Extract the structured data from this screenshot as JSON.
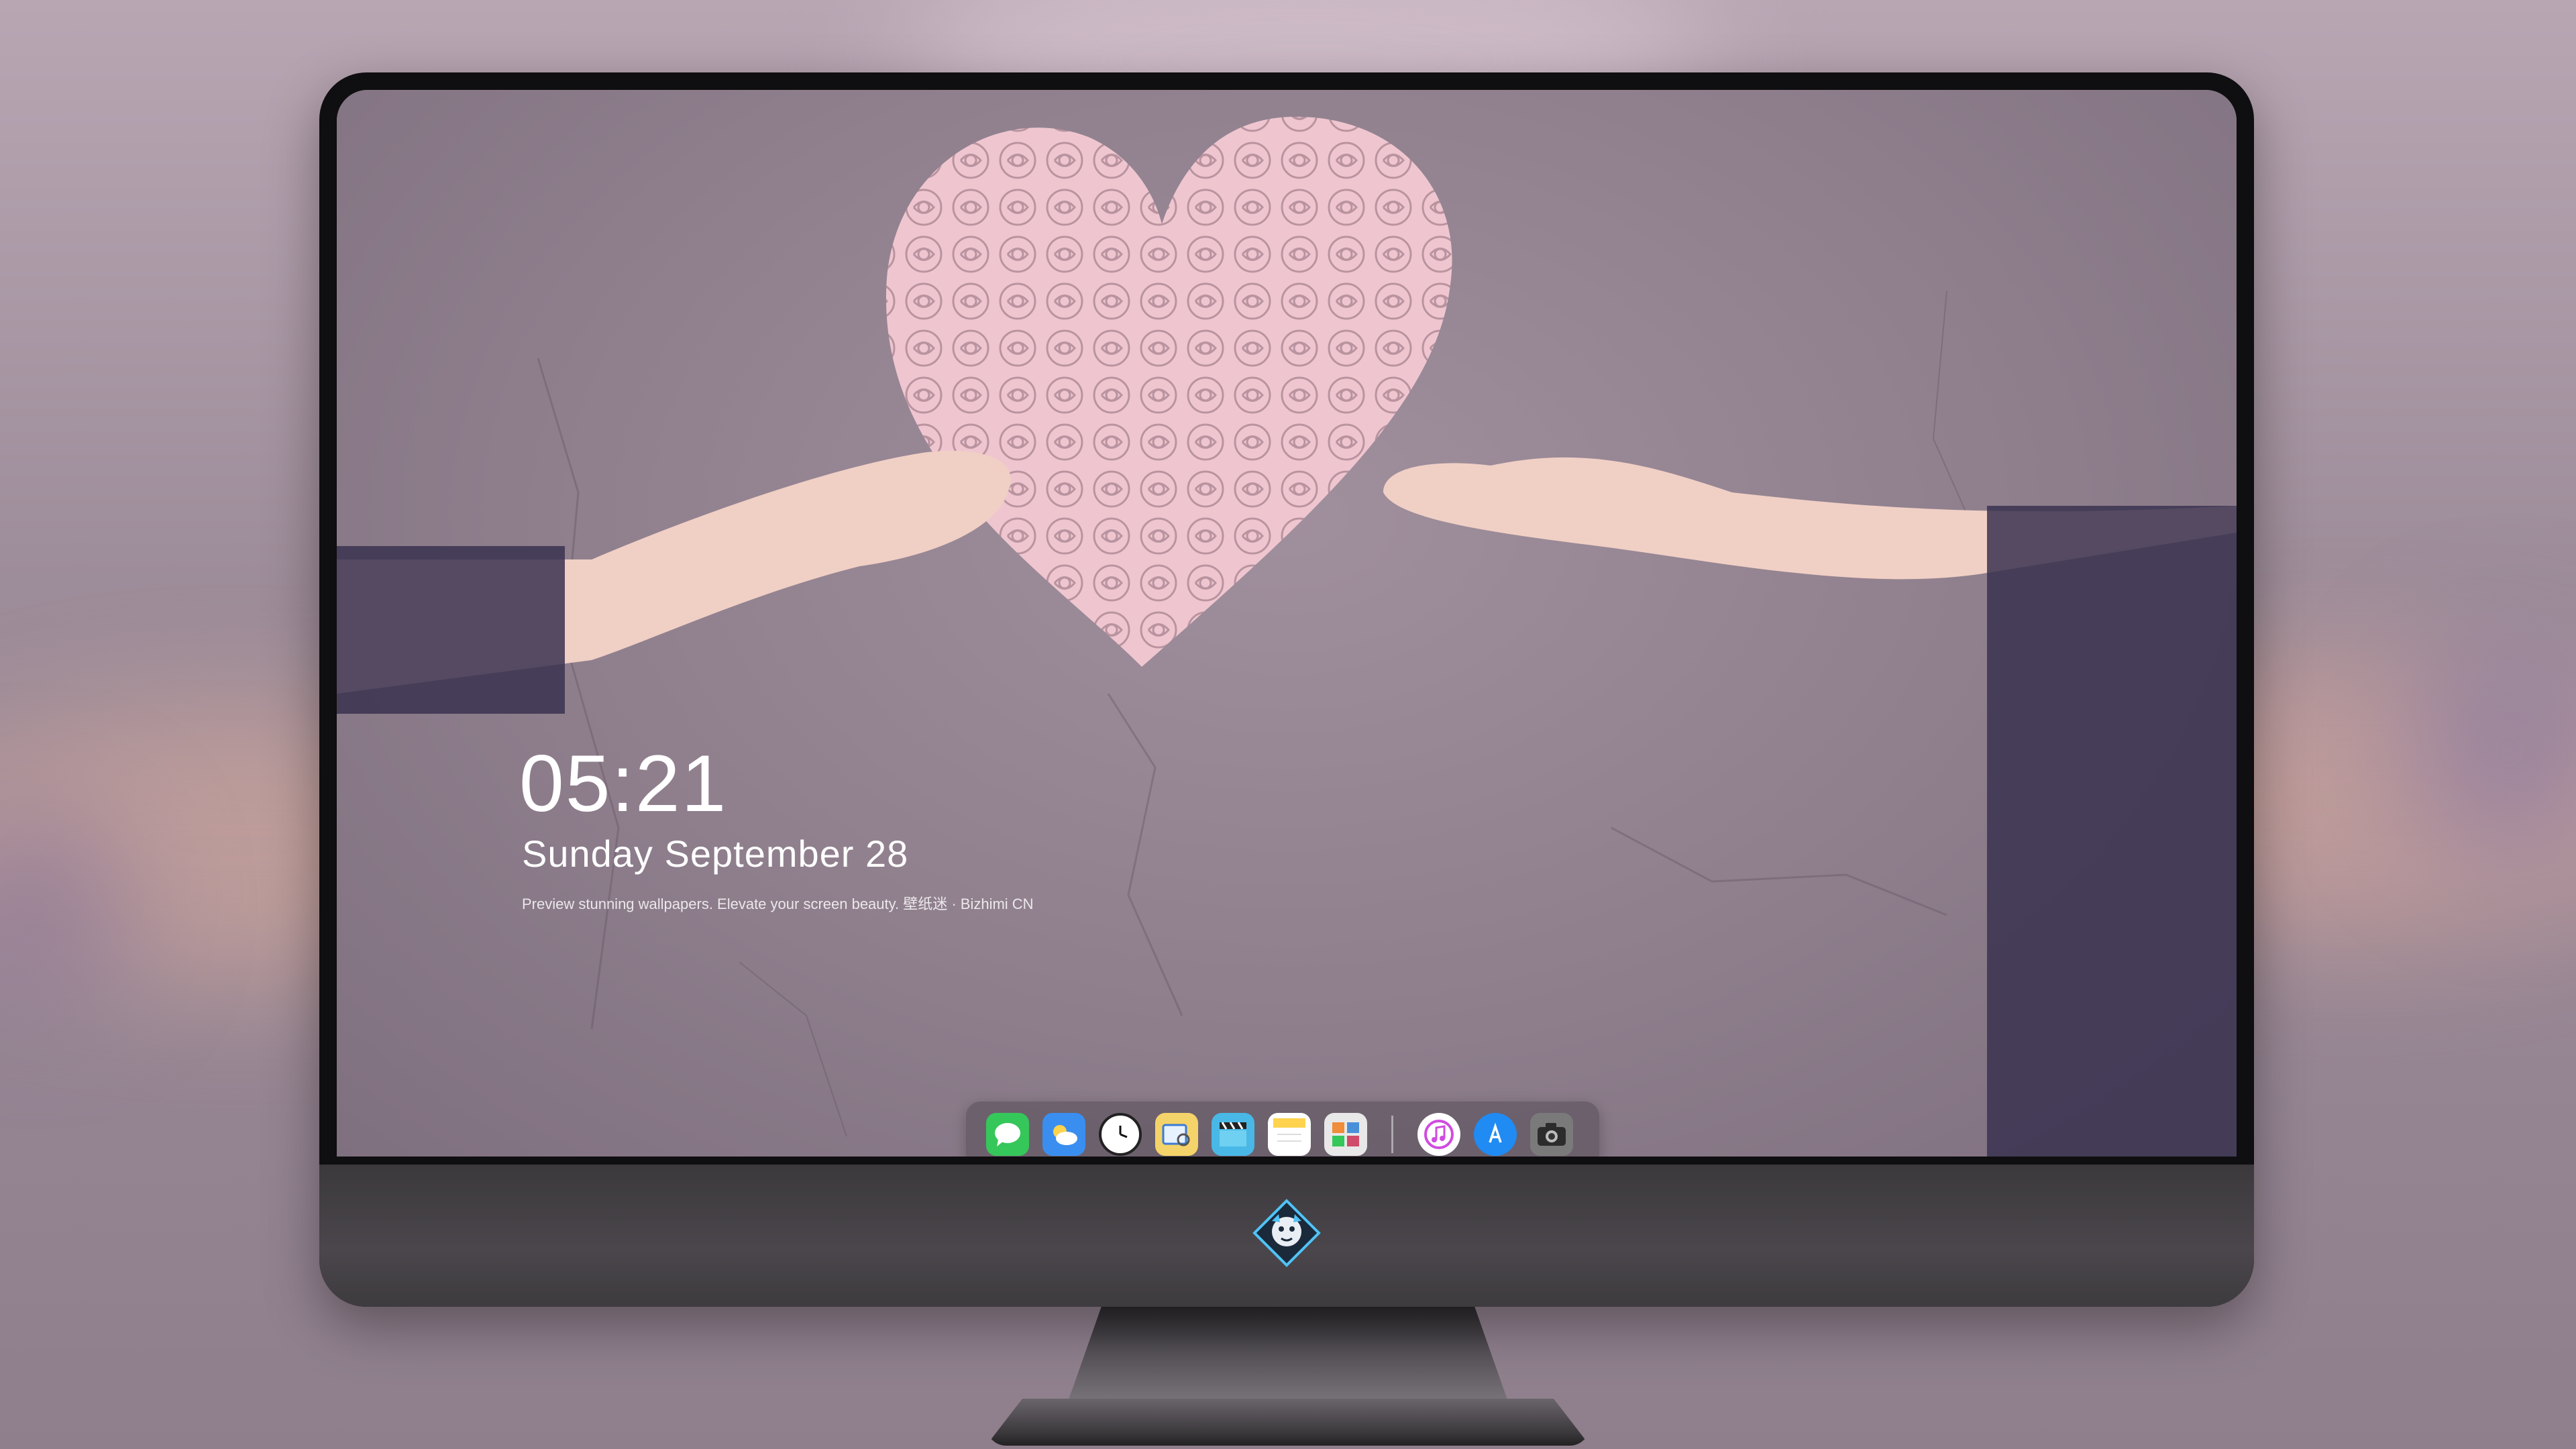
{
  "lock_screen": {
    "time": "05:21",
    "date": "Sunday September  28",
    "tagline": "Preview stunning wallpapers. Elevate your screen beauty. 壁纸迷 · Bizhimi CN"
  },
  "dock": {
    "apps": [
      {
        "name": "messages-icon",
        "color": "#35c759"
      },
      {
        "name": "weather-icon",
        "color": "#3a8ef0"
      },
      {
        "name": "clock-icon",
        "color": "#1a1a1a"
      },
      {
        "name": "preview-icon",
        "color": "#e9c55a"
      },
      {
        "name": "clips-icon",
        "color": "#49b8e6"
      },
      {
        "name": "notes-icon",
        "color": "#ffd34e"
      },
      {
        "name": "photo-browser-icon",
        "color": "#4a90d9"
      },
      {
        "name": "itunes-icon",
        "color": "#d04be0"
      },
      {
        "name": "app-store-icon",
        "color": "#1f8bf3"
      },
      {
        "name": "camera-icon",
        "color": "#6a6a6a"
      }
    ]
  },
  "monitor": {
    "logo": "dragon-mascot-logo"
  }
}
